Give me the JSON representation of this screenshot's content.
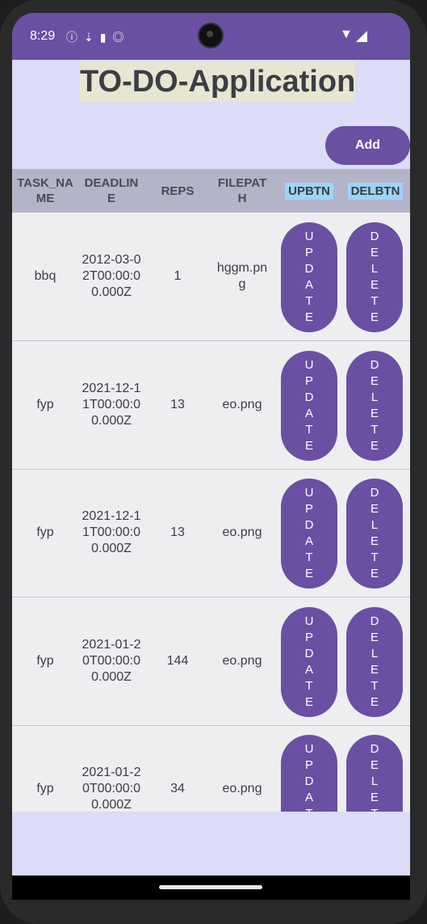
{
  "status": {
    "time": "8:29",
    "icons": [
      "info-icon",
      "download-icon",
      "sd-card-icon",
      "app-icon"
    ]
  },
  "header": {
    "title": "TO-DO-Application",
    "add_label": "Add"
  },
  "table": {
    "columns": [
      "TASK_NAME",
      "DEADLINE",
      "REPS",
      "FILEPATH",
      "UPBTN",
      "DELBTN"
    ],
    "update_label": "UPDATE",
    "delete_label": "DELETE",
    "rows": [
      {
        "task_name": "bbq",
        "deadline": "2012-03-02T00:00:00.000Z",
        "reps": "1",
        "filepath": "hggm.png"
      },
      {
        "task_name": "fyp",
        "deadline": "2021-12-11T00:00:00.000Z",
        "reps": "13",
        "filepath": "eo.png"
      },
      {
        "task_name": "fyp",
        "deadline": "2021-12-11T00:00:00.000Z",
        "reps": "13",
        "filepath": "eo.png"
      },
      {
        "task_name": "fyp",
        "deadline": "2021-01-20T00:00:00.000Z",
        "reps": "144",
        "filepath": "eo.png"
      },
      {
        "task_name": "fyp",
        "deadline": "2021-01-20T00:00:00.000Z",
        "reps": "34",
        "filepath": "eo.png"
      }
    ]
  },
  "colors": {
    "primary": "#6a4fa3",
    "background": "#dcdcf8",
    "header_bg": "#b4b4c8",
    "button_label_bg": "#9ed4f8"
  }
}
